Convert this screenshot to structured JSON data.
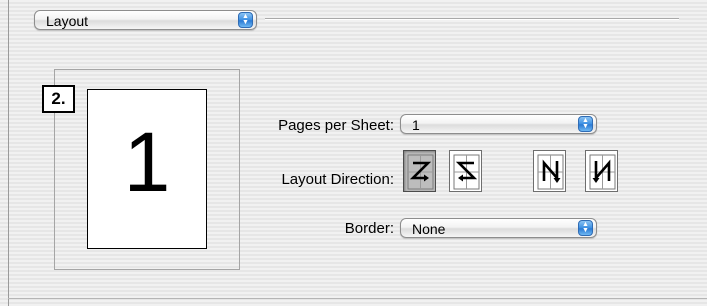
{
  "panel_select": {
    "value": "Layout"
  },
  "preview": {
    "badge": "2.",
    "page_number": "1"
  },
  "pages_per_sheet": {
    "label": "Pages per Sheet:",
    "value": "1"
  },
  "layout_direction": {
    "label": "Layout Direction:",
    "options": [
      {
        "icon": "z-direction-icon",
        "selected": true
      },
      {
        "icon": "reverse-z-direction-icon",
        "selected": false
      },
      {
        "icon": "n-direction-icon",
        "selected": false
      },
      {
        "icon": "reverse-n-direction-icon",
        "selected": false
      }
    ]
  },
  "border": {
    "label": "Border:",
    "value": "None"
  },
  "colors": {
    "accent": "#3b8ee2",
    "selected_button": "#bdbdbd"
  }
}
